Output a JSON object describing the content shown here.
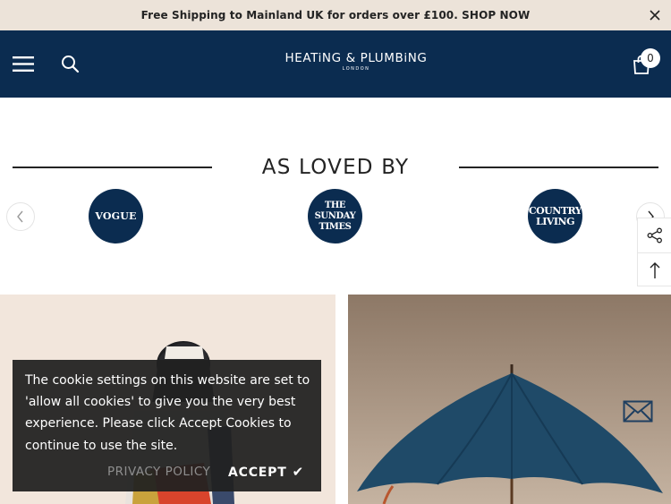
{
  "announcement": {
    "text": "Free Shipping to Mainland UK for orders over £100. SHOP NOW",
    "close_icon": "close-icon"
  },
  "header": {
    "menu_icon": "hamburger-menu-icon",
    "search_icon": "search-icon",
    "logo_main": "HEATiNG & PLUMBiNG",
    "logo_sub": "LONDON",
    "cart_icon": "shopping-bag-icon",
    "cart_count": "0",
    "background_color": "#0b2c50"
  },
  "loved_by": {
    "title": "AS LOVED BY",
    "prev_icon": "chevron-left-icon",
    "next_icon": "chevron-right-icon",
    "logos": [
      {
        "lines": [
          "VOGUE"
        ]
      },
      {
        "lines": [
          "THE",
          "SUNDAY",
          "TIMES"
        ]
      },
      {
        "lines": [
          "COUNTRY",
          "LIVING"
        ]
      }
    ]
  },
  "side_tools": {
    "share_icon": "share-icon",
    "back_to_top_icon": "arrow-up-icon"
  },
  "cookie": {
    "message": "The cookie settings on this website are set to 'allow all cookies' to give you the very best experience. Please click Accept Cookies to continue to use the site.",
    "policy_label": "PRIVACY POLICY",
    "accept_label": "ACCEPT",
    "accept_icon": "✔"
  },
  "contact": {
    "mail_icon": "envelope-icon"
  }
}
